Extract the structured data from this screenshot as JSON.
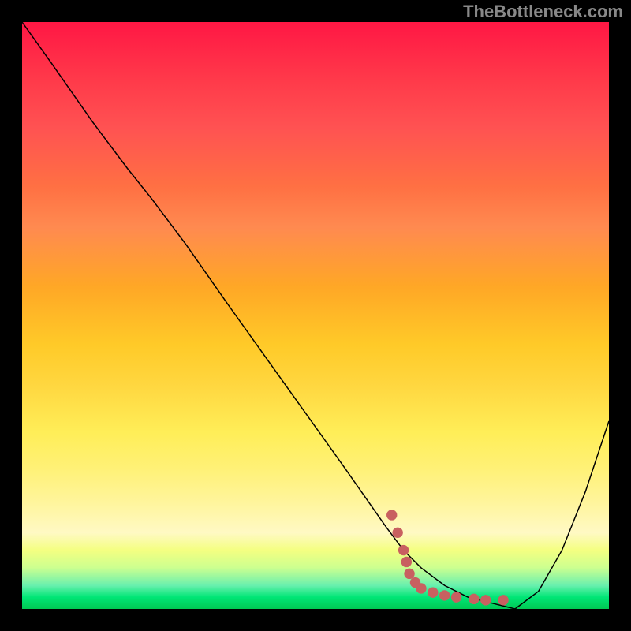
{
  "watermark": "TheBottleneck.com",
  "colors": {
    "curve": "#000000",
    "dots": "#c86060",
    "background_top": "#ff1744",
    "background_bottom": "#00c853"
  },
  "chart_data": {
    "type": "line",
    "title": "",
    "xlabel": "",
    "ylabel": "",
    "xlim": [
      0,
      100
    ],
    "ylim": [
      0,
      100
    ],
    "series": [
      {
        "name": "bottleneck-curve",
        "x": [
          0,
          5,
          12,
          18,
          22,
          28,
          35,
          45,
          55,
          62,
          65,
          68,
          72,
          76,
          80,
          84,
          88,
          92,
          96,
          100
        ],
        "y": [
          100,
          93,
          83,
          75,
          70,
          62,
          52,
          38,
          24,
          14,
          10,
          7,
          4,
          2,
          1,
          0,
          3,
          10,
          20,
          32
        ]
      }
    ],
    "scatter": {
      "name": "highlight-dots",
      "color": "#c86060",
      "points": [
        {
          "x": 63,
          "y": 16
        },
        {
          "x": 64,
          "y": 13
        },
        {
          "x": 65,
          "y": 10
        },
        {
          "x": 65.5,
          "y": 8
        },
        {
          "x": 66,
          "y": 6
        },
        {
          "x": 67,
          "y": 4.5
        },
        {
          "x": 68,
          "y": 3.5
        },
        {
          "x": 70,
          "y": 2.8
        },
        {
          "x": 72,
          "y": 2.3
        },
        {
          "x": 74,
          "y": 2.0
        },
        {
          "x": 77,
          "y": 1.7
        },
        {
          "x": 79,
          "y": 1.5
        },
        {
          "x": 82,
          "y": 1.5
        }
      ]
    }
  }
}
